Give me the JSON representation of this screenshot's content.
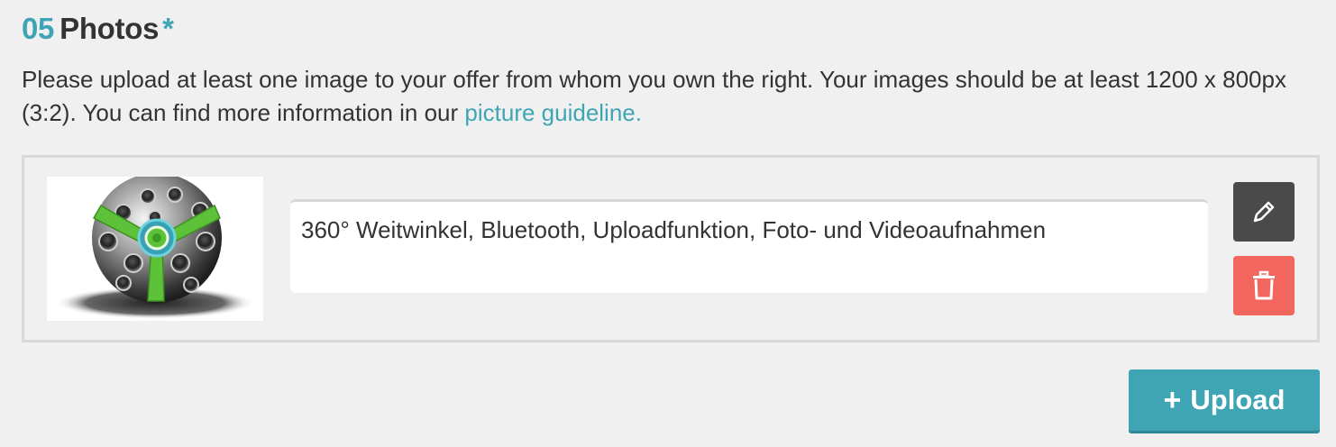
{
  "section": {
    "number": "05",
    "title": "Photos",
    "required_marker": "*",
    "description": "Please upload at least one image to your offer from whom you own the right. Your images should be at least 1200 x 800px (3:2). You can find more information in our",
    "link_text": "picture guideline."
  },
  "photo": {
    "thumbnail_icon": "360-camera-ball-image",
    "caption": "360° Weitwinkel, Bluetooth, Uploadfunktion, Foto- und Videoaufnahmen",
    "edit_icon": "pencil-icon",
    "delete_icon": "trash-icon"
  },
  "upload": {
    "icon": "+",
    "label": "Upload"
  },
  "colors": {
    "accent": "#3fa5b5",
    "edit_button": "#4a4a4a",
    "delete_button": "#f2665d",
    "text": "#333333",
    "background": "#f0f0f0"
  }
}
